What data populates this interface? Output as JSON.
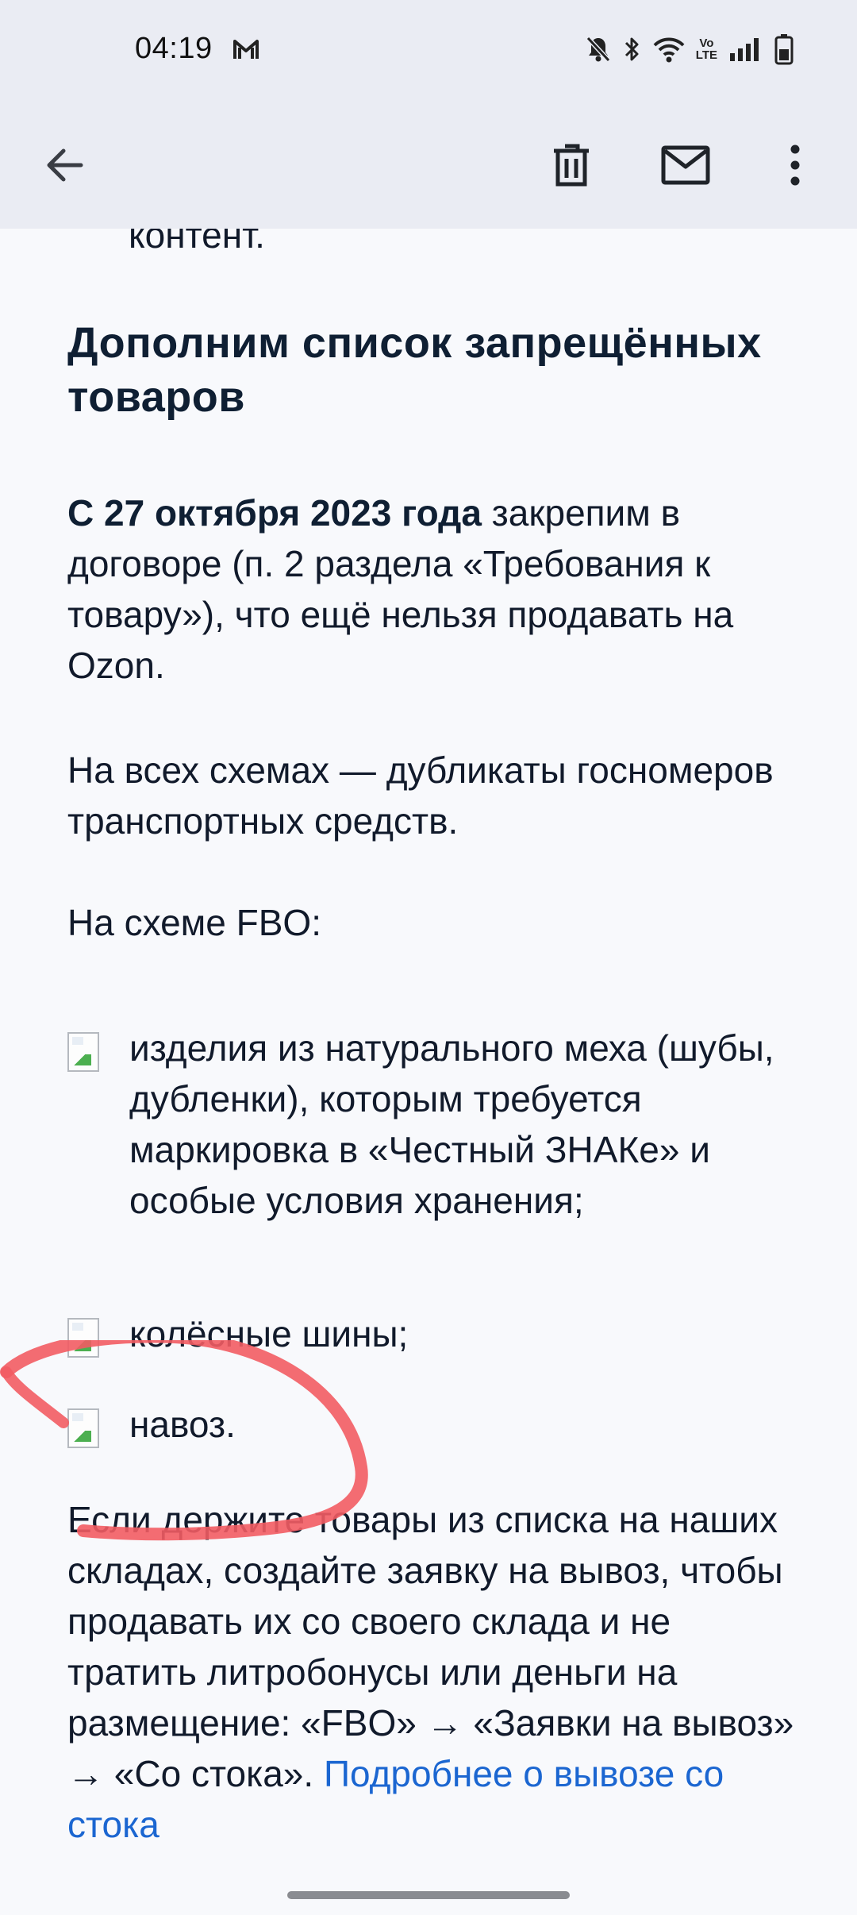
{
  "status_bar": {
    "time": "04:19",
    "left_icon": "gmail-m-icon",
    "right_icons": [
      "bell-off-icon",
      "bluetooth-icon",
      "wifi-icon",
      "volte-icon",
      "signal-icon",
      "battery-icon"
    ],
    "volte_label_top": "Vo",
    "volte_label_bottom": "LTE"
  },
  "app_bar": {
    "back_icon": "arrow-back-icon",
    "delete_icon": "trash-icon",
    "mail_icon": "envelope-icon",
    "more_icon": "more-vertical-icon"
  },
  "email": {
    "cut_line": "контент.",
    "heading": "Дополним список запрещённых товаров",
    "p1_bold": "С 27 октября 2023 года",
    "p1_rest": " закрепим в договоре (п. 2 раздела «Требования к товару»), что ещё нельзя продавать на Ozon.",
    "p2": "На всех схемах — дубликаты госномеров транспортных средств.",
    "p3": "На схеме FBO:",
    "list": [
      "изделия из натурального меха (шубы, дубленки), которым требуется маркировка в «Честный ЗНАКе» и особые условия хранения;",
      "колёсные шины;",
      "навоз."
    ],
    "p4_text": "Если держите товары из списка на наших складах, создайте заявку на вывоз, чтобы продавать их со своего склада и не тратить литробонусы или деньги на размещение: «FBO» → «Заявки на вывоз» → «Со стока». ",
    "p4_link": "Подробнее о вывозе со стока"
  },
  "colors": {
    "bar_background": "#eaecf3",
    "page_background": "#f8f9fc",
    "text": "#111a2b",
    "link": "#1b66d1",
    "annotation": "#f25c63"
  }
}
